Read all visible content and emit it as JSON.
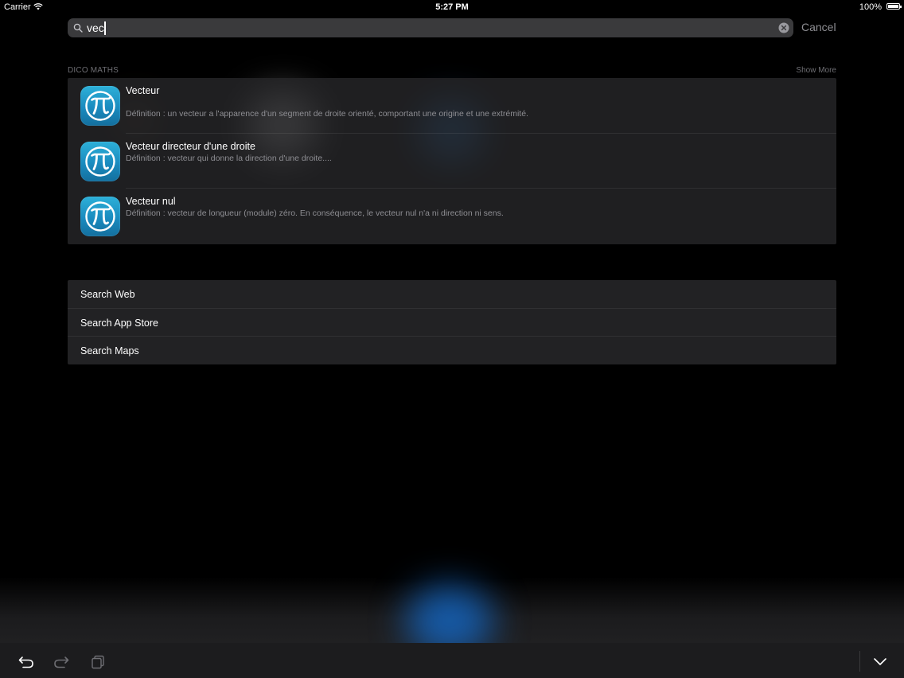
{
  "status_bar": {
    "carrier": "Carrier",
    "time": "5:27 PM",
    "battery": "100%"
  },
  "search": {
    "value": "vec",
    "cancel_label": "Cancel"
  },
  "section": {
    "title": "DICO MATHS",
    "show_more": "Show More"
  },
  "results": [
    {
      "title": "Vecteur",
      "description": "Définition : un vecteur a l'apparence d'un segment de droite orienté, comportant une origine et une extrémité."
    },
    {
      "title": "Vecteur directeur d'une droite",
      "description": "Définition : vecteur qui donne la direction d'une droite...."
    },
    {
      "title": "Vecteur nul",
      "description": "Définition : vecteur de longueur (module) zéro. En conséquence, le vecteur nul n'a ni direction ni sens."
    }
  ],
  "search_options": [
    {
      "label": "Search Web"
    },
    {
      "label": "Search App Store"
    },
    {
      "label": "Search Maps"
    }
  ],
  "icons": {
    "app": "pi-icon",
    "search": "search-icon",
    "clear": "clear-icon",
    "undo": "undo-icon",
    "redo": "redo-icon",
    "paste": "paste-icon",
    "dismiss": "dismiss-keyboard-icon"
  },
  "colors": {
    "app_icon_blue": "#1a8bbf",
    "secondary_text": "#8e8e93",
    "search_field": "#3a3a3c"
  }
}
